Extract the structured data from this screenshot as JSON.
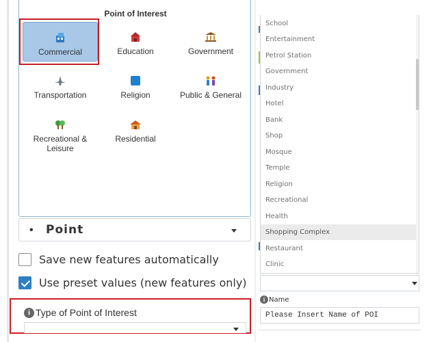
{
  "poi_panel": {
    "title": "Point of Interest",
    "categories": [
      {
        "label": "Commercial",
        "icon": "commercial-icon",
        "selected": true
      },
      {
        "label": "Education",
        "icon": "education-icon",
        "selected": false
      },
      {
        "label": "Government",
        "icon": "government-icon",
        "selected": false
      },
      {
        "label": "Transportation",
        "icon": "transportation-icon",
        "selected": false
      },
      {
        "label": "Religion",
        "icon": "religion-icon",
        "selected": false
      },
      {
        "label": "Public & General",
        "icon": "public-general-icon",
        "selected": false
      },
      {
        "label": "Recreational & Leisure",
        "icon": "recreational-leisure-icon",
        "selected": false
      },
      {
        "label": "Residential",
        "icon": "residential-icon",
        "selected": false
      }
    ]
  },
  "geometry_select": {
    "value": "Point",
    "bullet": "•"
  },
  "options": {
    "save_new_features": {
      "label": "Save new features automatically",
      "checked": false
    },
    "use_preset_values": {
      "label": "Use preset values (new features only)",
      "checked": true
    }
  },
  "type_field": {
    "label": "Type of Point of Interest",
    "value": ""
  },
  "type_dropdown": {
    "options": [
      "School",
      "Entertainment",
      "Petrol Station",
      "Government",
      "Industry",
      "Hotel",
      "Bank",
      "Shop",
      "Mosque",
      "Temple",
      "Religion",
      "Recreational",
      "Health",
      "Shopping Complex",
      "Restaurant",
      "Clinic"
    ],
    "highlighted": "Shopping Complex",
    "value": ""
  },
  "name_field": {
    "label": "Name",
    "value": "Please Insert Name of POI"
  },
  "colors": {
    "selection_highlight": "#a9c8e8",
    "annotation_red": "#c81d25",
    "checkbox_blue": "#2f7fc1"
  }
}
